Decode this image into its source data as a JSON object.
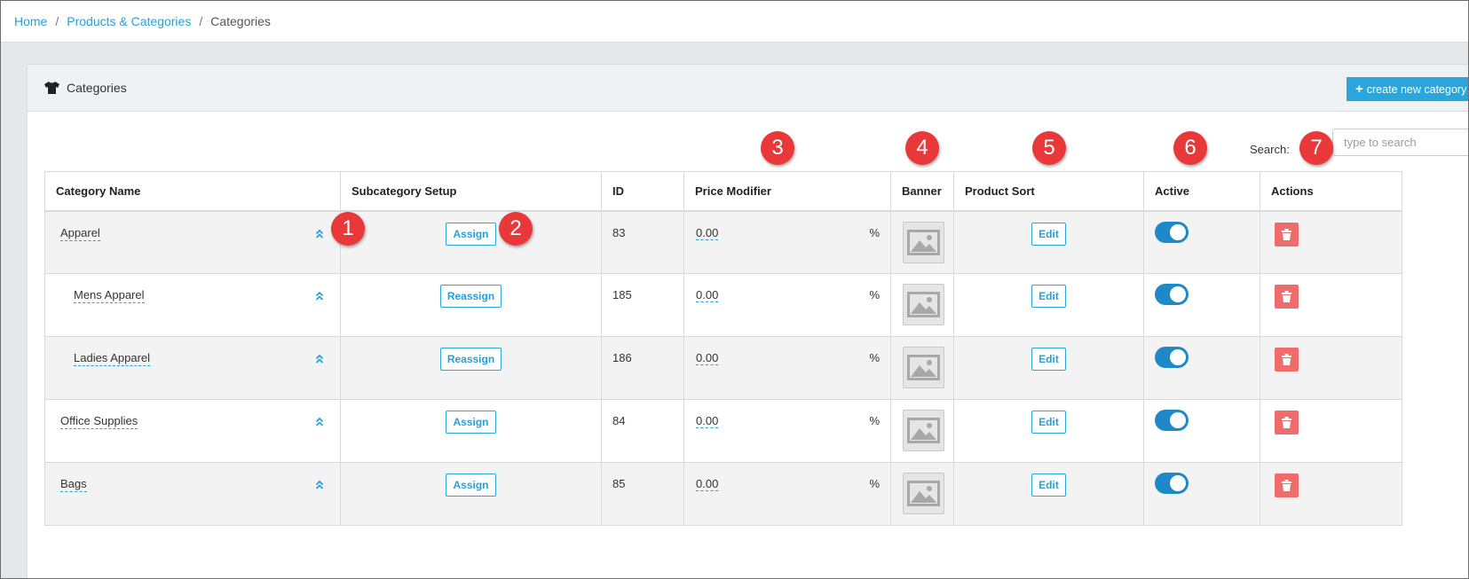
{
  "breadcrumb": {
    "items": [
      "Home",
      "Products & Categories"
    ],
    "current": "Categories"
  },
  "panel": {
    "title": "Categories",
    "icon": "tshirt-icon",
    "create_button_label": "create new category"
  },
  "search": {
    "label": "Search:",
    "placeholder": "type to search"
  },
  "table": {
    "headers": {
      "category_name": "Category Name",
      "subcategory_setup": "Subcategory Setup",
      "id": "ID",
      "price_modifier": "Price Modifier",
      "banner": "Banner",
      "product_sort": "Product Sort",
      "active": "Active",
      "actions": "Actions"
    },
    "rows": [
      {
        "name": "Apparel",
        "subcategory_button": "Assign",
        "id": "83",
        "price_modifier": "0.00",
        "unit": "%",
        "product_sort_button": "Edit",
        "active": true
      },
      {
        "name": "Mens Apparel",
        "subcategory_button": "Reassign",
        "id": "185",
        "price_modifier": "0.00",
        "unit": "%",
        "product_sort_button": "Edit",
        "active": true
      },
      {
        "name": "Ladies Apparel",
        "subcategory_button": "Reassign",
        "id": "186",
        "price_modifier": "0.00",
        "unit": "%",
        "product_sort_button": "Edit",
        "active": true
      },
      {
        "name": "Office Supplies",
        "subcategory_button": "Assign",
        "id": "84",
        "price_modifier": "0.00",
        "unit": "%",
        "product_sort_button": "Edit",
        "active": true
      },
      {
        "name": "Bags",
        "subcategory_button": "Assign",
        "id": "85",
        "price_modifier": "0.00",
        "unit": "%",
        "product_sort_button": "Edit",
        "active": true
      }
    ]
  },
  "annotations": [
    "1",
    "2",
    "3",
    "4",
    "5",
    "6",
    "7"
  ],
  "colors": {
    "accent": "#29a6db",
    "toggle_on": "#1f88c9",
    "delete": "#ef6c6c",
    "marker": "#e8383a"
  }
}
